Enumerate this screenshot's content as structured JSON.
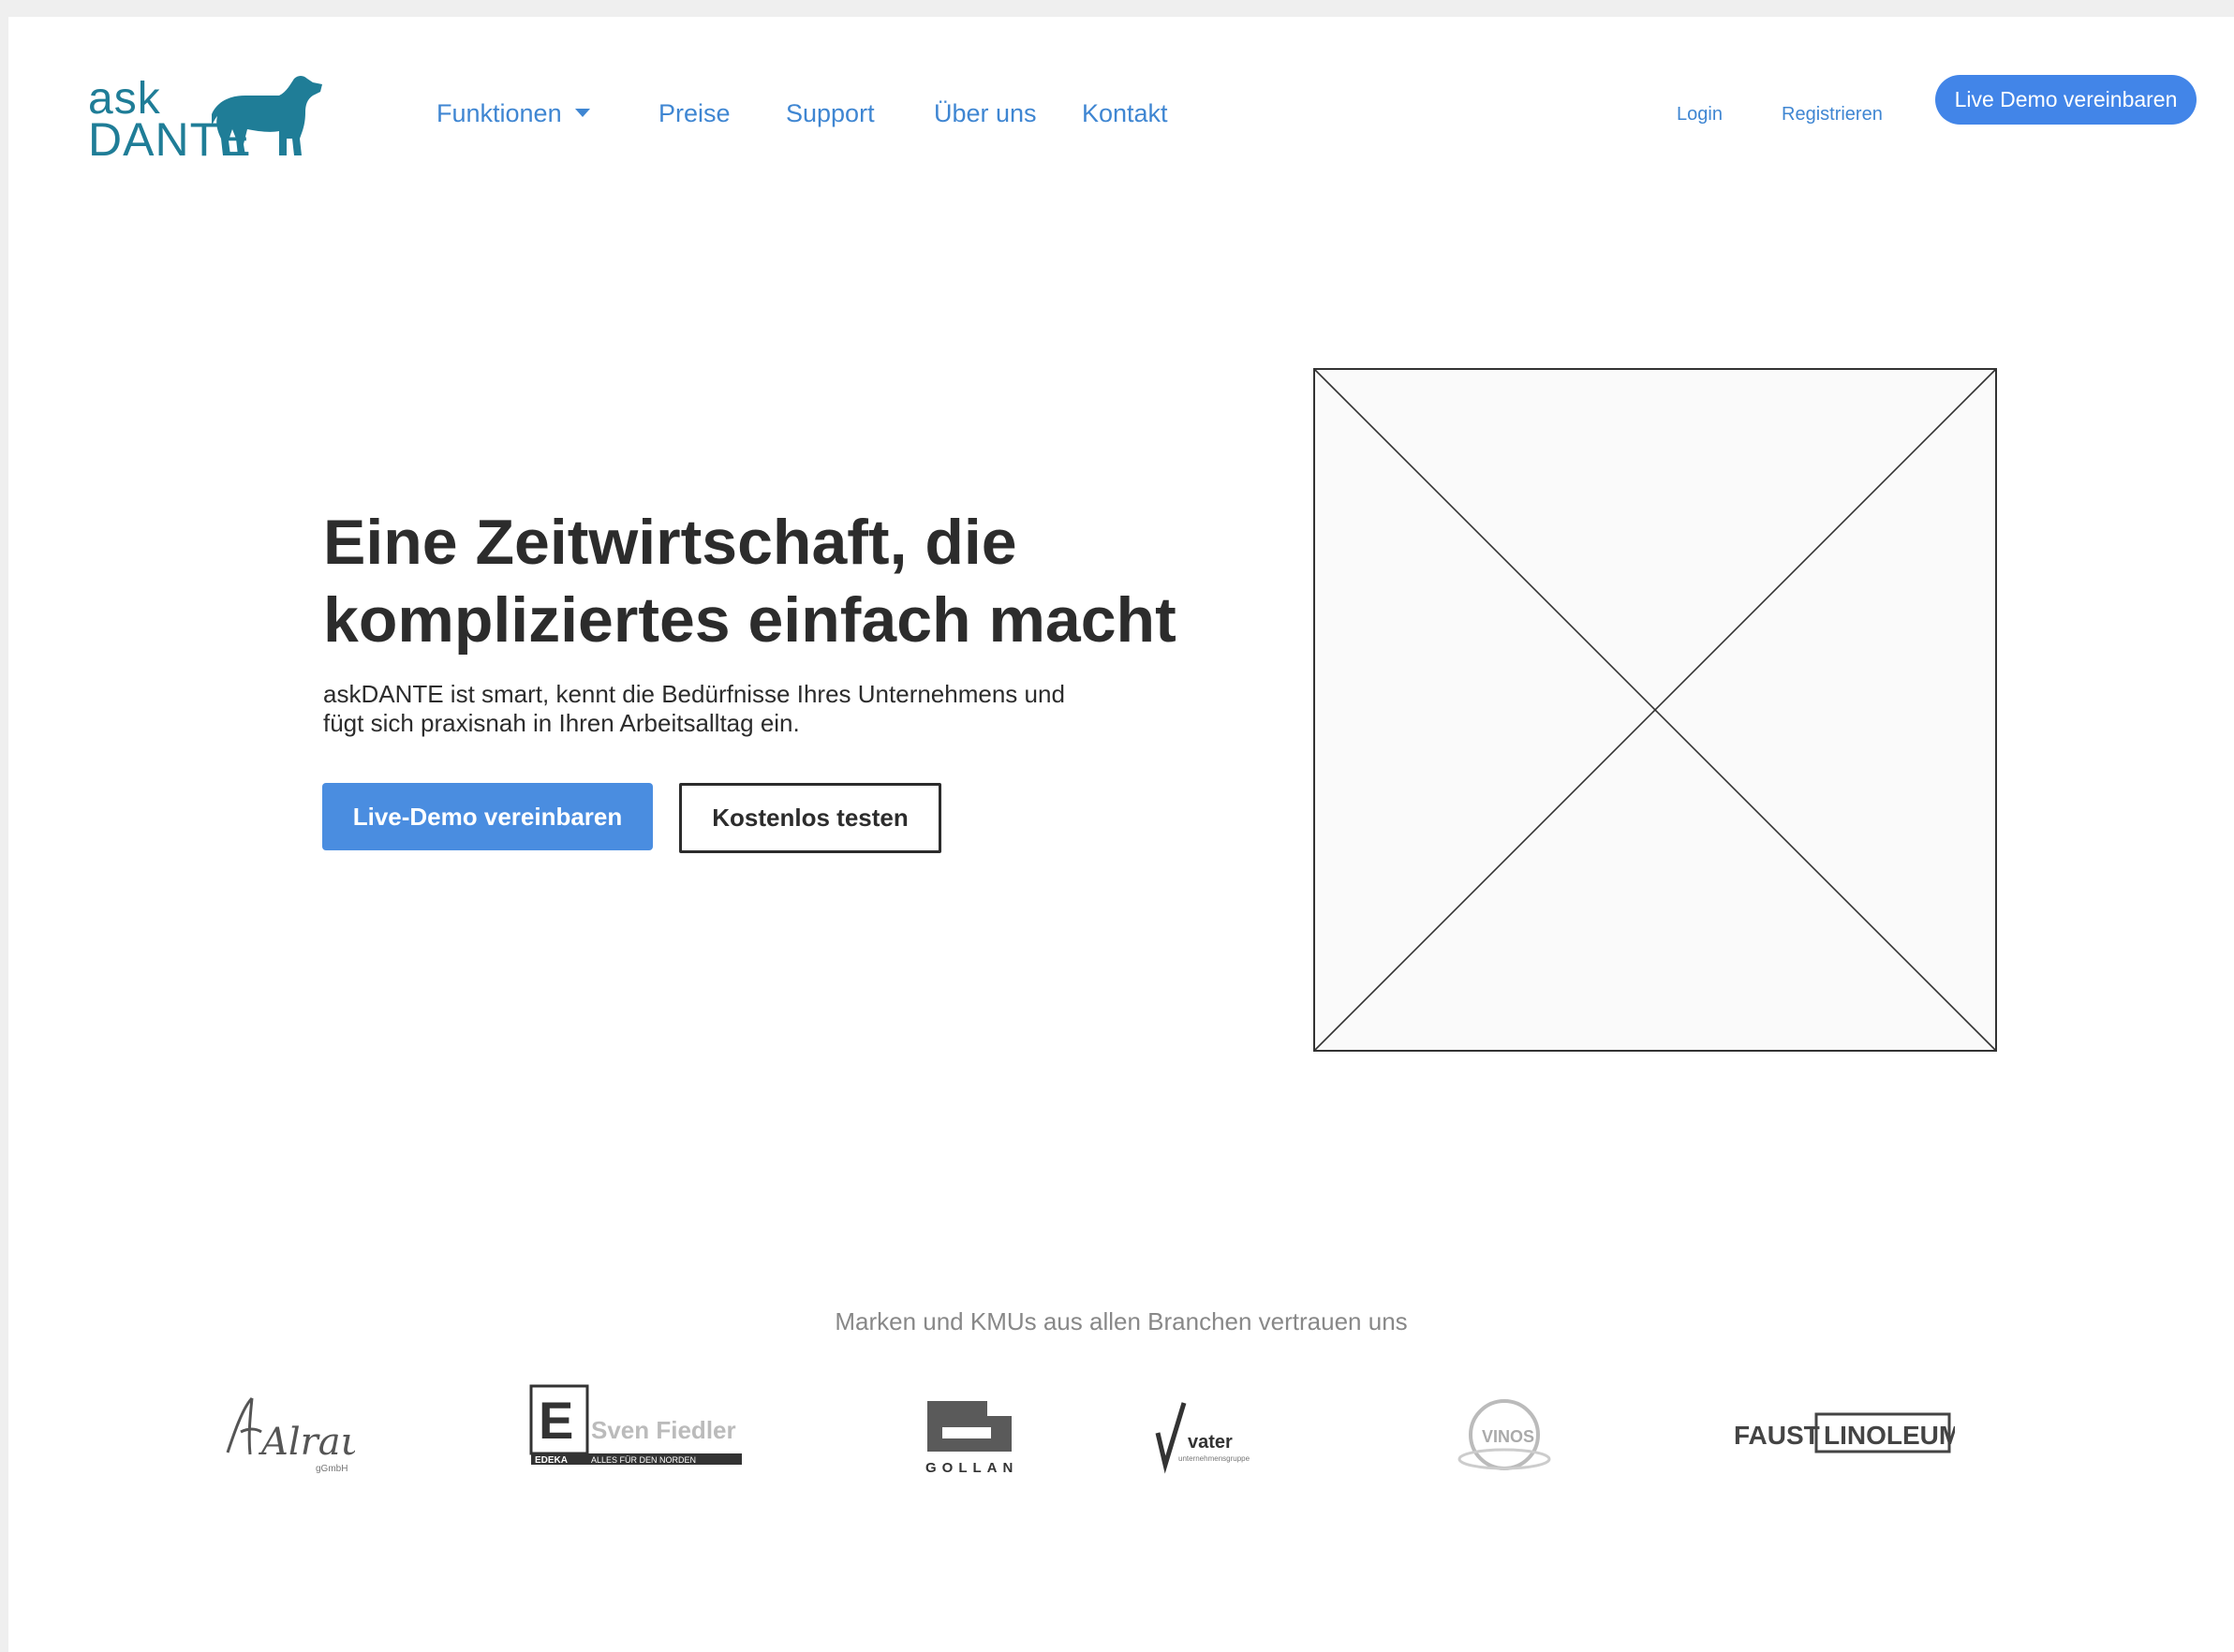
{
  "logo": {
    "ask": "ask",
    "dante": "DANTE",
    "mascot": "dog-icon",
    "color": "#1f7d97"
  },
  "nav": {
    "items": [
      {
        "label": "Funktionen",
        "has_dropdown": true
      },
      {
        "label": "Preise"
      },
      {
        "label": "Support"
      },
      {
        "label": "Über uns"
      },
      {
        "label": "Kontakt"
      }
    ],
    "link_color": "#3f86d2"
  },
  "auth": {
    "login": "Login",
    "register": "Registrieren"
  },
  "header_cta": {
    "label": "Live Demo vereinbaren",
    "color": "#4285e8"
  },
  "hero": {
    "title_line1": "Eine Zeitwirtschaft, die",
    "title_line2": "kompliziertes einfach macht",
    "subtitle_line1": "askDANTE ist smart, kennt die Bedürfnisse Ihres Unternehmens und",
    "subtitle_line2": "fügt sich praxisnah in Ihren Arbeitsalltag ein.",
    "primary_button": "Live-Demo vereinbaren",
    "secondary_button": "Kostenlos testen",
    "image": "image-placeholder-icon"
  },
  "trust": {
    "caption": "Marken und KMUs aus allen Branchen vertrauen uns",
    "logos": [
      {
        "name": "Alraune",
        "sub": "gGmbH"
      },
      {
        "name": "Sven Fiedler",
        "mark": "E",
        "tag": "EDEKA",
        "slogan": "ALLES FÜR DEN NORDEN"
      },
      {
        "name": "GOLLAN"
      },
      {
        "name": "vater",
        "sub": "unternehmensgruppe"
      },
      {
        "name": "VINOS"
      },
      {
        "name_a": "FAUST",
        "name_b": "LINOLEUM"
      }
    ]
  }
}
